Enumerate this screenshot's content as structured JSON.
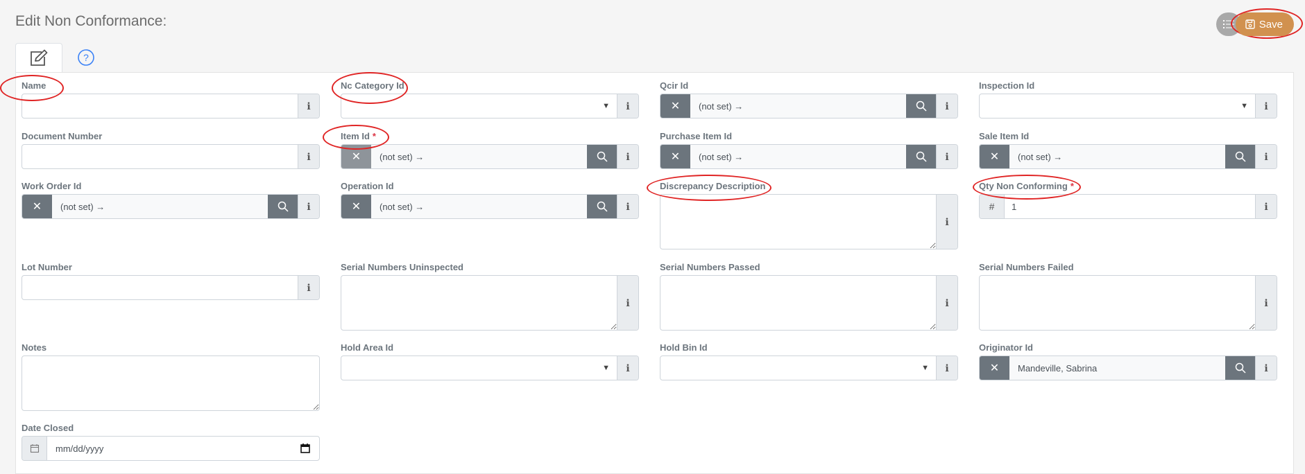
{
  "header": {
    "title": "Edit Non Conformance:",
    "save_label": "Save",
    "list_icon": "list-icon",
    "save_icon": "floppy-disk-icon"
  },
  "tabs": [
    {
      "name": "edit",
      "icon": "edit-icon",
      "active": true
    },
    {
      "name": "help",
      "icon": "question-circle-icon",
      "active": false
    }
  ],
  "colors": {
    "save_button": "#d1914f",
    "annotation": "#e02424",
    "required": "#dc3545",
    "lookup_button": "#6c757d"
  },
  "fields": {
    "name": {
      "label": "Name",
      "value": ""
    },
    "nc_category_id": {
      "label": "Nc Category Id",
      "value": ""
    },
    "qcir_id": {
      "label": "Qcir Id",
      "value": "(not set) →"
    },
    "inspection_id": {
      "label": "Inspection Id",
      "value": ""
    },
    "document_number": {
      "label": "Document Number",
      "value": ""
    },
    "item_id": {
      "label": "Item Id",
      "required": "*",
      "value": "(not set) →"
    },
    "purchase_item_id": {
      "label": "Purchase Item Id",
      "value": "(not set) →"
    },
    "sale_item_id": {
      "label": "Sale Item Id",
      "value": "(not set) →"
    },
    "work_order_id": {
      "label": "Work Order Id",
      "value": "(not set) →"
    },
    "operation_id": {
      "label": "Operation Id",
      "value": "(not set) →"
    },
    "discrepancy_description": {
      "label": "Discrepancy Description",
      "value": ""
    },
    "qty_non_conforming": {
      "label": "Qty Non Conforming",
      "required": "*",
      "prefix": "#",
      "value": "1"
    },
    "lot_number": {
      "label": "Lot Number",
      "value": ""
    },
    "serial_numbers_uninspected": {
      "label": "Serial Numbers Uninspected",
      "value": ""
    },
    "serial_numbers_passed": {
      "label": "Serial Numbers Passed",
      "value": ""
    },
    "serial_numbers_failed": {
      "label": "Serial Numbers Failed",
      "value": ""
    },
    "notes": {
      "label": "Notes",
      "value": ""
    },
    "hold_area_id": {
      "label": "Hold Area Id",
      "value": ""
    },
    "hold_bin_id": {
      "label": "Hold Bin Id",
      "value": ""
    },
    "originator_id": {
      "label": "Originator Id",
      "value": "Mandeville, Sabrina"
    },
    "date_closed": {
      "label": "Date Closed",
      "placeholder": "mm/dd/yyyy",
      "value": ""
    }
  },
  "annotations": [
    "save-button",
    "name-label",
    "nc-category-id-label",
    "item-id-label",
    "discrepancy-description-label",
    "qty-non-conforming-label"
  ]
}
